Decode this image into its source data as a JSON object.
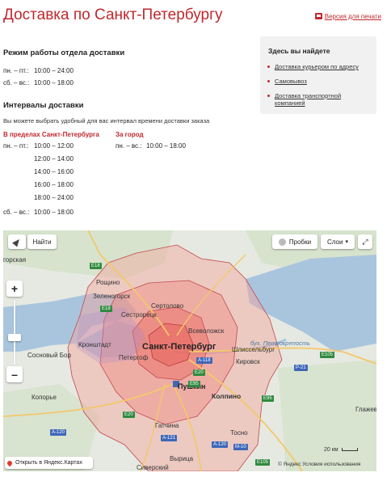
{
  "page": {
    "title": "Доставка по Санкт-Петербургу",
    "print_link": "Версия для печати"
  },
  "hours": {
    "heading": "Режим работы отдела доставки",
    "rows": [
      {
        "days": "пн. – пт.:",
        "time": "10:00 – 24:00"
      },
      {
        "days": "сб. – вс.:",
        "time": "10:00 – 18:00"
      }
    ]
  },
  "intervals": {
    "heading": "Интервалы доставки",
    "note": "Вы можете выбрать удобный для вас интервал времени доставки заказа",
    "city": {
      "heading": "В пределах Санкт-Петербурга",
      "weekday_label": "пн. – пт.:",
      "weekday_slots": [
        "10:00 – 12:00",
        "12:00 – 14:00",
        "14:00 – 16:00",
        "16:00 – 18:00",
        "18:00 – 24:00"
      ],
      "weekend_label": "сб. – вс.:",
      "weekend_slot": "10:00 – 18:00"
    },
    "outside": {
      "heading": "За город",
      "label": "пн. – вс.:",
      "slot": "10:00 – 18:00"
    }
  },
  "aside": {
    "heading": "Здесь вы найдете",
    "links": [
      "Доставка курьером по адресу",
      "Самовывоз",
      "Доставка транспортной компанией"
    ]
  },
  "map": {
    "controls": {
      "search": "Найти",
      "traffic": "Пробки",
      "layers": "Слои",
      "zoom_in": "+",
      "zoom_out": "–",
      "open_link": "Открыть в Яндекс.Картах",
      "scale": "20 км",
      "copyright": "© Яндекс Условия использования"
    },
    "labels": {
      "spb": "Санкт-Петербург",
      "pushkin": "Пушкин",
      "kolpino": "Колпино",
      "kronshtadt": "Кронштадт",
      "petergof": "Петергоф",
      "sestroretsk": "Сестрорецк",
      "sertolovo": "Сертолово",
      "zelenogorsk": "Зеленогорск",
      "vsevolozhsk": "Всеволожск",
      "shlisselburg": "Шлиссельбург",
      "kirovsk": "Кировск",
      "gatchina": "Гатчина",
      "tosno": "Тосно",
      "sosnovy_bor": "Сосновый Бор",
      "koporye": "Копорье",
      "roshchino": "Рощино",
      "vyritsa": "Вырица",
      "siversky": "Сиверский",
      "glazhevo": "Глажево",
      "gorskaya": "горская",
      "petrokrepost": "бух. Петрокрепость"
    },
    "roads": [
      "E18",
      "E18",
      "A-118",
      "E20",
      "E95",
      "A-120",
      "E20",
      "A-120",
      "A-121",
      "E95",
      "E105",
      "M-10",
      "E105",
      "P-21"
    ]
  },
  "colors": {
    "accent": "#c0282d",
    "zone_fill": "#f4a49c",
    "water": "#a8c4de",
    "land": "#e9ebe5"
  }
}
